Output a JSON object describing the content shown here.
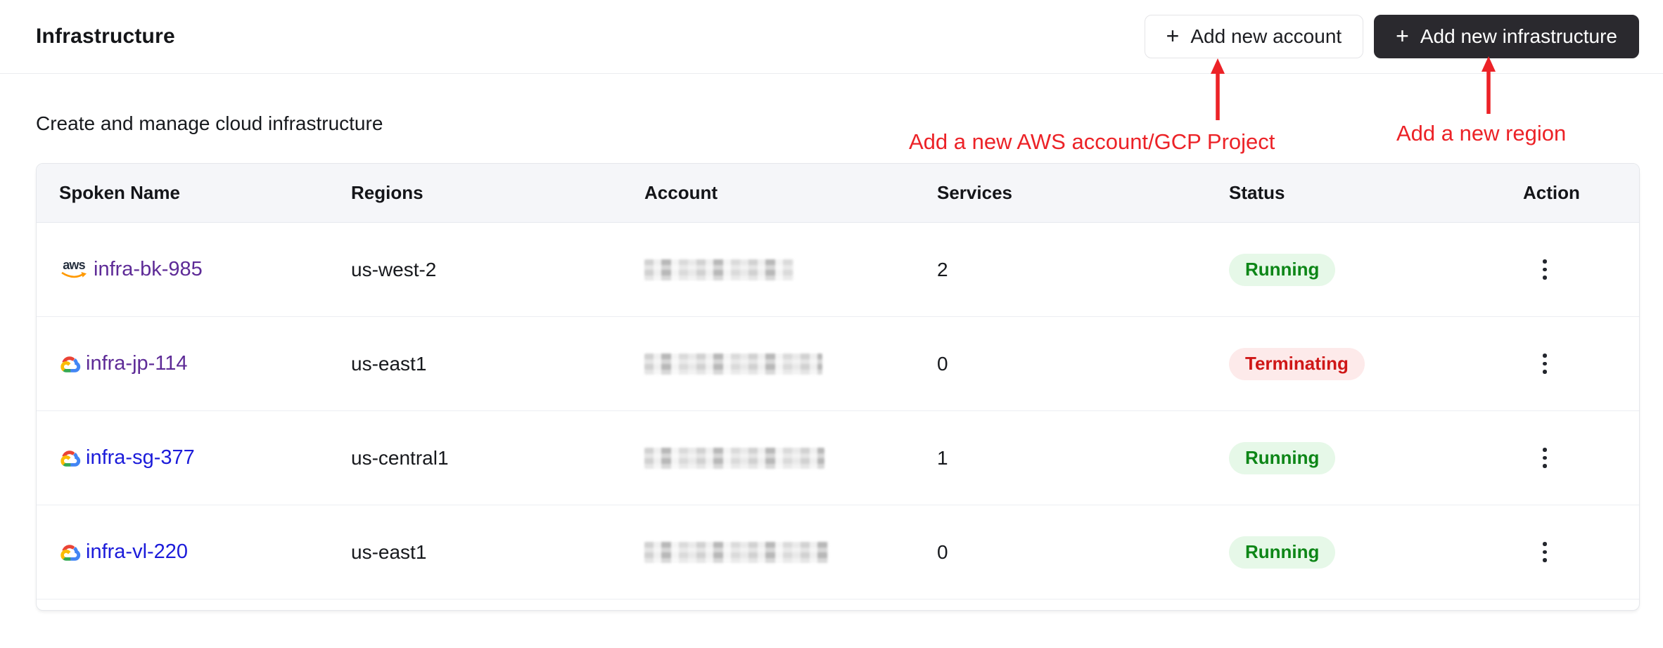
{
  "page": {
    "title": "Infrastructure",
    "subtitle": "Create and manage cloud infrastructure"
  },
  "toolbar": {
    "plus_glyph": "+",
    "add_account_label": "Add new account",
    "add_infrastructure_label": "Add new infrastructure"
  },
  "annotations": {
    "color": "#EC2227",
    "account_note": "Add a new AWS account/GCP Project",
    "region_note": "Add a new region"
  },
  "icons": {
    "aws_text": "aws",
    "aws_swoosh_color": "#FF9900",
    "gcp_logo": "gcp-multicolor-cloud",
    "kebab": "kebab-vertical-dots"
  },
  "table": {
    "columns": [
      "Spoken Name",
      "Regions",
      "Account",
      "Services",
      "Status",
      "Action"
    ],
    "account_redacted": true,
    "rows": [
      {
        "name": "infra-bk-985",
        "provider": "aws",
        "region": "us-west-2",
        "services": "2",
        "status": "Running",
        "link_state": "visited"
      },
      {
        "name": "infra-jp-114",
        "provider": "gcp",
        "region": "us-east1",
        "services": "0",
        "status": "Terminating",
        "link_state": "visited"
      },
      {
        "name": "infra-sg-377",
        "provider": "gcp",
        "region": "us-central1",
        "services": "1",
        "status": "Running",
        "link_state": "unvisited"
      },
      {
        "name": "infra-vl-220",
        "provider": "gcp",
        "region": "us-east1",
        "services": "0",
        "status": "Running",
        "link_state": "unvisited"
      }
    ]
  },
  "colors": {
    "primary_button_bg": "#2A292E",
    "link_visited": "#5E2B97",
    "link_unvisited": "#1B1BDA",
    "status_running_bg": "#E6F8E8",
    "status_running_text": "#0D8617",
    "status_terminating_bg": "#FDEAEA",
    "status_terminating_text": "#CF1717",
    "header_row_bg": "#F5F6F9"
  }
}
